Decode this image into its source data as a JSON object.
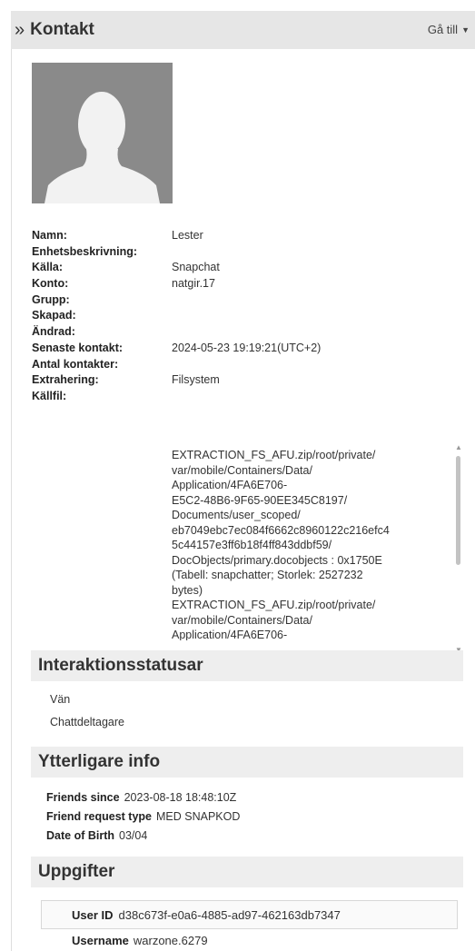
{
  "header": {
    "title": "Kontakt",
    "goto_label": "Gå till"
  },
  "properties": [
    {
      "key": "Namn:",
      "value": "Lester"
    },
    {
      "key": "Enhetsbeskrivning:",
      "value": ""
    },
    {
      "key": "Källa:",
      "value": "Snapchat"
    },
    {
      "key": "Konto:",
      "value": "natgir.17"
    },
    {
      "key": "Grupp:",
      "value": ""
    },
    {
      "key": "Skapad:",
      "value": ""
    },
    {
      "key": "Ändrad:",
      "value": ""
    },
    {
      "key": "Senaste kontakt:",
      "value": "2024-05-23 19:19:21(UTC+2)"
    },
    {
      "key": "Antal kontakter:",
      "value": ""
    },
    {
      "key": "Extrahering:",
      "value": "Filsystem"
    },
    {
      "key": "Källfil:",
      "value": ""
    }
  ],
  "source_file": {
    "lines": [
      "EXTRACTION_FS_AFU.zip/root/private/",
      "var/mobile/Containers/Data/",
      "Application/4FA6E706-",
      "E5C2-48B6-9F65-90EE345C8197/",
      "Documents/user_scoped/",
      "eb7049ebc7ec084f6662c8960122c216efc4",
      "5c44157e3ff6b18f4ff843ddbf59/",
      "DocObjects/primary.docobjects : 0x1750E",
      "(Tabell: snapchatter; Storlek: 2527232",
      "bytes)",
      "EXTRACTION_FS_AFU.zip/root/private/",
      "var/mobile/Containers/Data/",
      "Application/4FA6E706-"
    ]
  },
  "interaction_section": {
    "title": "Interaktionsstatusar",
    "items": [
      "Vän",
      "Chattdeltagare"
    ]
  },
  "extra_section": {
    "title": "Ytterligare info",
    "rows": [
      {
        "key": "Friends since",
        "value": "2023-08-18 18:48:10Z"
      },
      {
        "key": "Friend request type",
        "value": "MED SNAPKOD"
      },
      {
        "key": "Date of Birth",
        "value": "03/04"
      }
    ]
  },
  "details_section": {
    "title": "Uppgifter",
    "user_id_key": "User ID",
    "user_id_value": "d38c673f-e0a6-4885-ad97-462163db7347",
    "username_key": "Username",
    "username_value": "warzone.6279"
  },
  "colors": {
    "header_bg": "#e6e6e6",
    "section_bg": "#eeeeee",
    "avatar_bg": "#8a8a8a"
  }
}
